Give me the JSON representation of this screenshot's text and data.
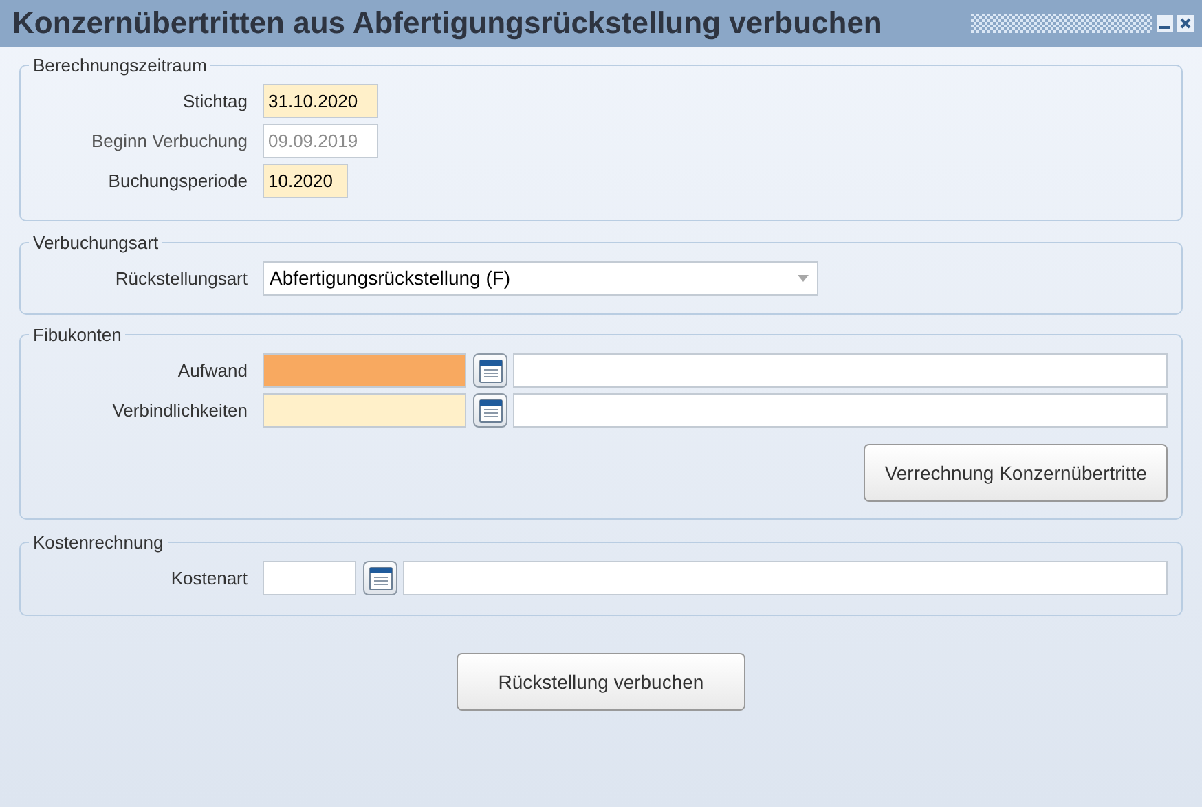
{
  "window": {
    "title": "Konzernübertritten aus Abfertigungsrückstellung verbuchen"
  },
  "sections": [
    {
      "legend": "Berechnungszeitraum",
      "kind": "dates",
      "rows": [
        {
          "label": "Stichtag",
          "value": "31.10.2020",
          "required": true,
          "disabled": false
        },
        {
          "label": "Beginn Verbuchung",
          "value": "09.09.2019",
          "required": false,
          "disabled": true
        },
        {
          "label": "Buchungsperiode",
          "value": "10.2020",
          "required": true,
          "disabled": false
        }
      ]
    },
    {
      "legend": "Verbuchungsart",
      "kind": "select",
      "rows": [
        {
          "label": "Rückstellungsart",
          "value": "Abfertigungsrückstellung (F)"
        }
      ]
    },
    {
      "legend": "Fibukonten",
      "kind": "accounts",
      "rows": [
        {
          "label": "Aufwand",
          "missing": true
        },
        {
          "label": "Verbindlichkeiten",
          "required": true,
          "missing": false
        }
      ],
      "button": "Verrechnung Konzernübertritte"
    },
    {
      "legend": "Kostenrechnung",
      "kind": "cost",
      "rows": [
        {
          "label": "Kostenart",
          "required": false,
          "missing": false
        }
      ]
    }
  ],
  "main_button": "Rückstellung verbuchen"
}
